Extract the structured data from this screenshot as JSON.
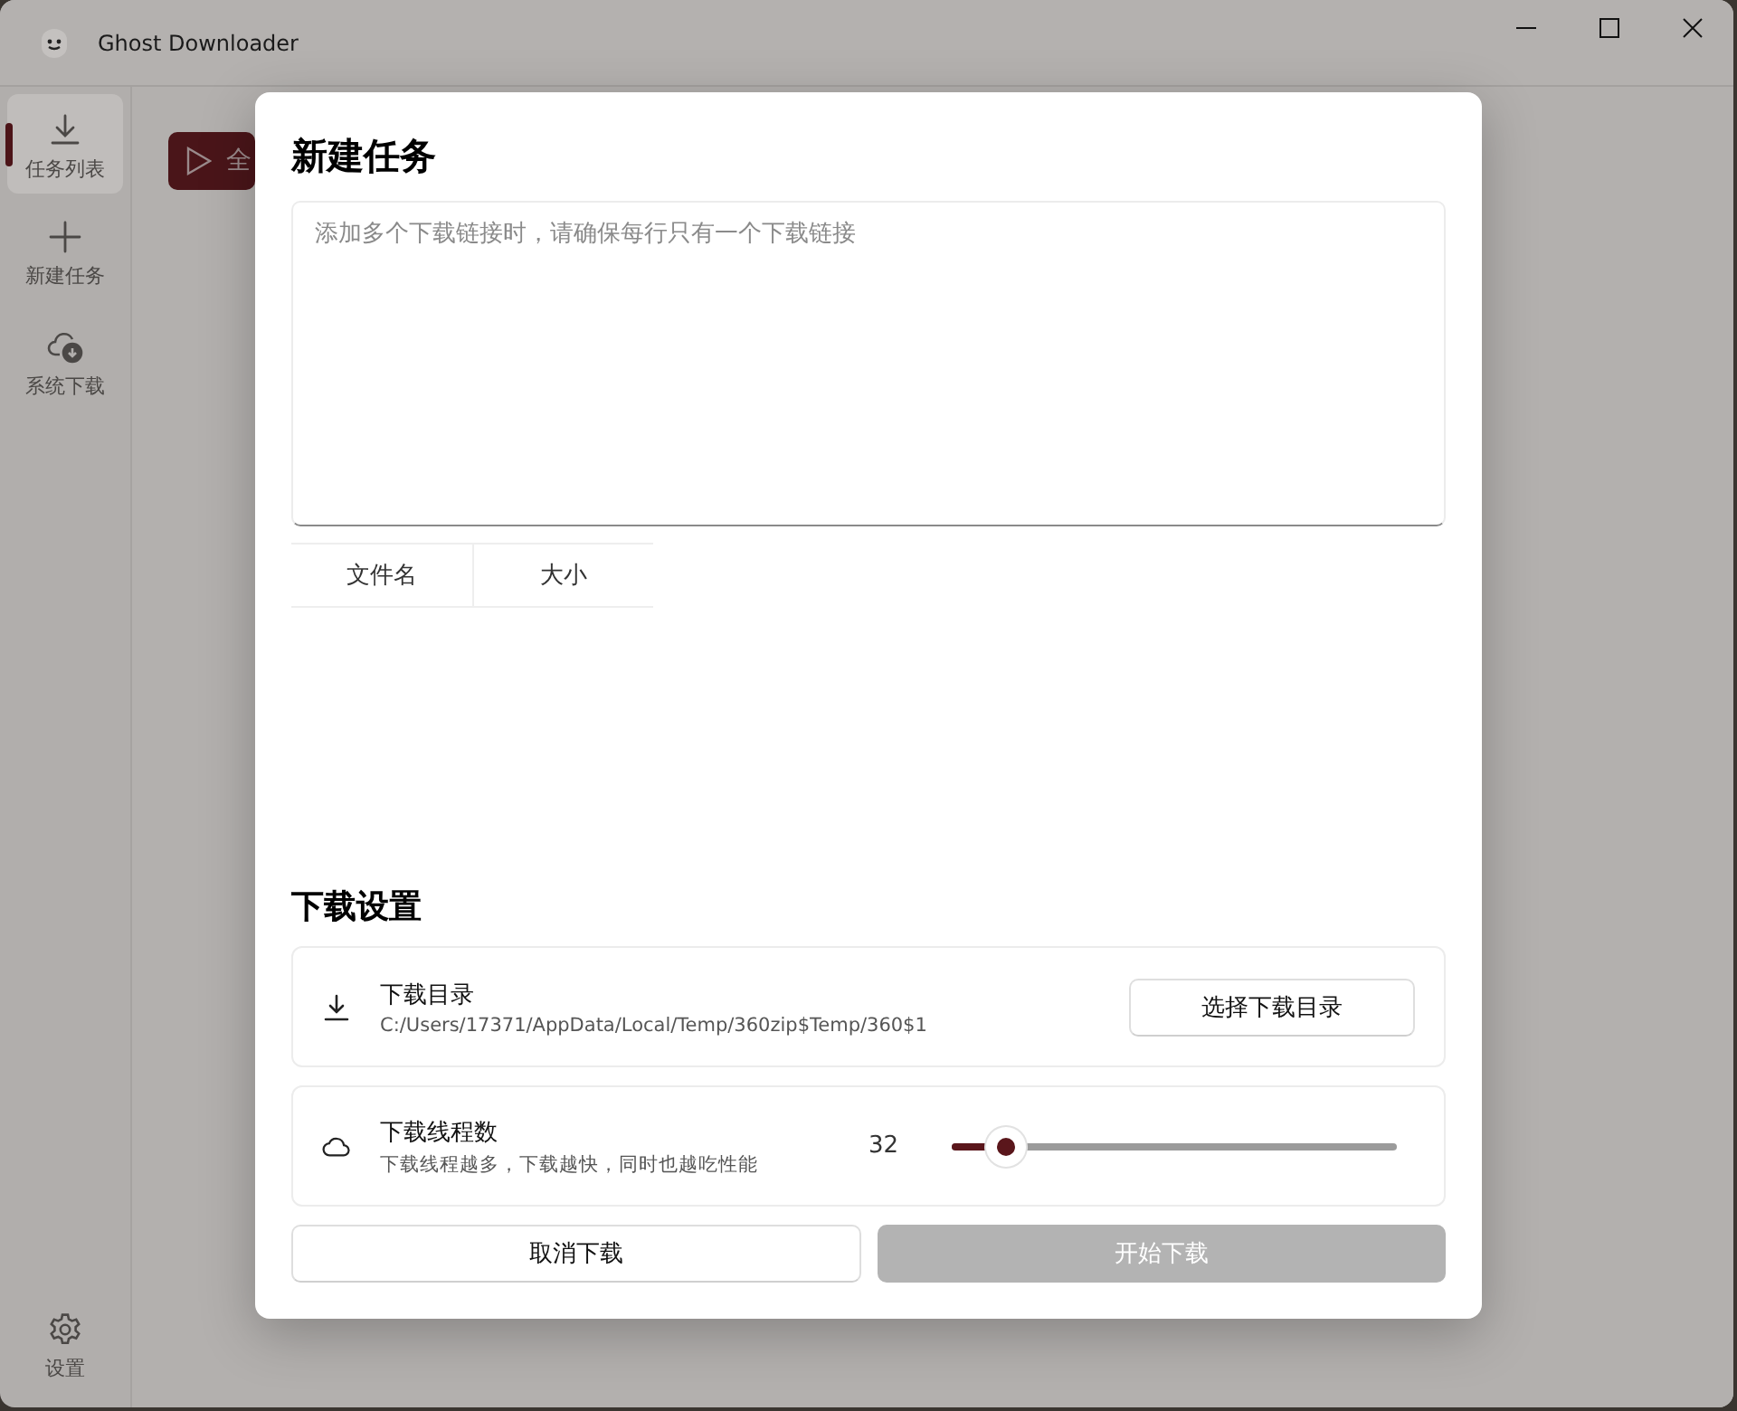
{
  "window": {
    "title": "Ghost Downloader"
  },
  "sidebar": {
    "items": [
      {
        "kind": "download",
        "label": "任务列表",
        "selected": true
      },
      {
        "kind": "plus",
        "label": "新建任务",
        "selected": false
      },
      {
        "kind": "cloud",
        "label": "系统下载",
        "selected": false
      }
    ],
    "footer": {
      "kind": "gear",
      "label": "设置",
      "selected": false
    }
  },
  "toolbar": {
    "button": {
      "label": "全"
    }
  },
  "dialog": {
    "title": "新建任务",
    "links_field": {
      "placeholder": "添加多个下载链接时，请确保每行只有一个下载链接"
    },
    "table": {
      "columns": [
        "文件名",
        "大小"
      ]
    },
    "settings_title": "下载设置",
    "settings": [
      {
        "kind": "folder",
        "title": "下载目录",
        "description": "C:/Users/17371/AppData/Local/Temp/360zip$Temp/360$1",
        "button": "选择下载目录"
      },
      {
        "kind": "slider",
        "title": "下载线程数",
        "description": "下载线程越多，下载越快，同时也越吃性能",
        "reading": "32",
        "level": 0.12
      }
    ],
    "buttons": [
      {
        "label": "取消下载",
        "disabled": false
      },
      {
        "label": "开始下载",
        "disabled": true
      }
    ]
  }
}
